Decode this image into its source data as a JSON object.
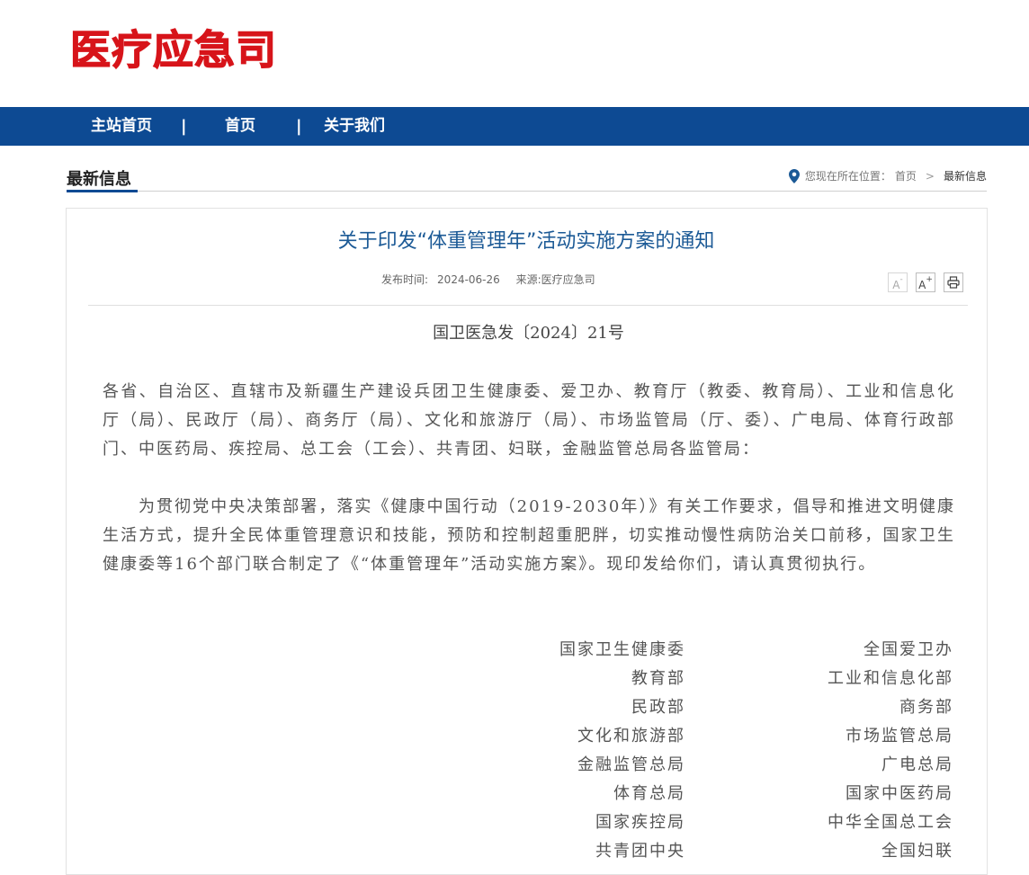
{
  "site": {
    "logo_text": "医疗应急司"
  },
  "nav": {
    "items": [
      "主站首页",
      "首页",
      "关于我们"
    ],
    "separator": "|"
  },
  "section": {
    "title": "最新信息"
  },
  "breadcrumb": {
    "prefix": "您现在所在位置：",
    "home": "首页",
    "chevron": ">",
    "current": "最新信息"
  },
  "article": {
    "title": "关于印发“体重管理年”活动实施方案的通知",
    "publish_label": "发布时间:",
    "publish_date": "2024-06-26",
    "source_label": "来源:",
    "source": "医疗应急司",
    "tools": {
      "font_smaller": "A",
      "font_larger": "A",
      "plus": "+",
      "minus": "-"
    },
    "doc_number": "国卫医急发〔2024〕21号",
    "addressee": "各省、自治区、直辖市及新疆生产建设兵团卫生健康委、爱卫办、教育厅（教委、教育局）、工业和信息化厅（局）、民政厅（局）、商务厅（局）、文化和旅游厅（局）、市场监管局（厅、委）、广电局、体育行政部门、中医药局、疾控局、总工会（工会）、共青团、妇联，金融监管总局各监管局：",
    "main_text": "为贯彻党中央决策部署，落实《健康中国行动（2019-2030年）》有关工作要求，倡导和推进文明健康生活方式，提升全民体重管理意识和技能，预防和控制超重肥胖，切实推动慢性病防治关口前移，国家卫生健康委等16个部门联合制定了《“体重管理年”活动实施方案》。现印发给你们，请认真贯彻执行。",
    "signatories_left": [
      "国家卫生健康委",
      "教育部",
      "民政部",
      "文化和旅游部",
      "金融监管总局",
      "体育总局",
      "国家疾控局",
      "共青团中央"
    ],
    "signatories_right": [
      "全国爱卫办",
      "工业和信息化部",
      "商务部",
      "市场监管总局",
      "广电总局",
      "国家中医药局",
      "中华全国总工会",
      "全国妇联"
    ]
  },
  "colors": {
    "logo_red": "#d7141a",
    "nav_blue": "#0d4a93",
    "title_blue": "#1c5a96"
  }
}
